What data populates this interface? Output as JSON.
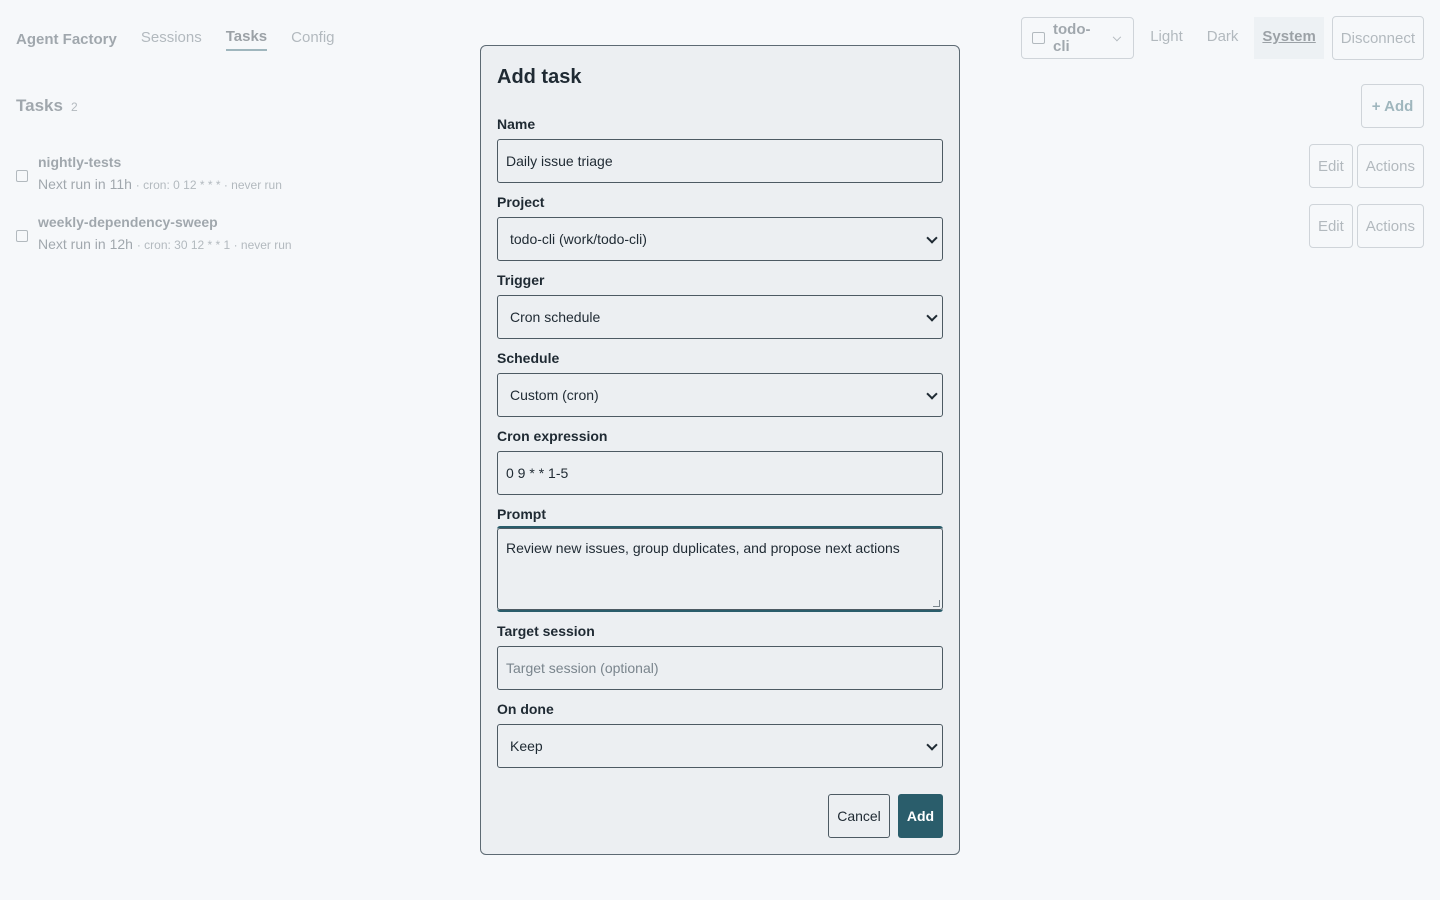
{
  "nav": {
    "brand": "Agent Factory",
    "links": [
      "Sessions",
      "Tasks",
      "Config"
    ],
    "active": "Tasks"
  },
  "topbar": {
    "project": "todo-cli",
    "themes": [
      "Light",
      "Dark",
      "System"
    ],
    "active_theme": "System",
    "disconnect": "Disconnect"
  },
  "tasks": {
    "title": "Tasks",
    "count": "2",
    "add_label": "+ Add",
    "items": [
      {
        "name": "nightly-tests",
        "next": "Next run in 11h",
        "meta": "· cron: 0 12 * * * · never run",
        "edit": "Edit",
        "actions": "Actions"
      },
      {
        "name": "weekly-dependency-sweep",
        "next": "Next run in 12h",
        "meta": "· cron: 30 12 * * 1 · never run",
        "edit": "Edit",
        "actions": "Actions"
      }
    ]
  },
  "modal": {
    "title": "Add task",
    "fields": {
      "name": {
        "label": "Name",
        "value": "Daily issue triage"
      },
      "project": {
        "label": "Project",
        "value": "todo-cli (work/todo-cli)"
      },
      "trigger": {
        "label": "Trigger",
        "value": "Cron schedule"
      },
      "schedule": {
        "label": "Schedule",
        "value": "Custom (cron)"
      },
      "cron": {
        "label": "Cron expression",
        "value": "0 9 * * 1-5"
      },
      "prompt": {
        "label": "Prompt",
        "value": "Review new issues, group duplicates, and propose next actions"
      },
      "target_session": {
        "label": "Target session",
        "placeholder": "Target session (optional)"
      },
      "on_done": {
        "label": "On done",
        "value": "Keep"
      }
    },
    "cancel": "Cancel",
    "add": "Add"
  },
  "colors": {
    "accent": "#2a5d6b",
    "background": "#f6f8fa",
    "modal_bg": "#eceff2"
  },
  "icons": {
    "project": "folder-icon",
    "dropdown": "chevron-down-icon",
    "task": "checkbox-icon"
  }
}
